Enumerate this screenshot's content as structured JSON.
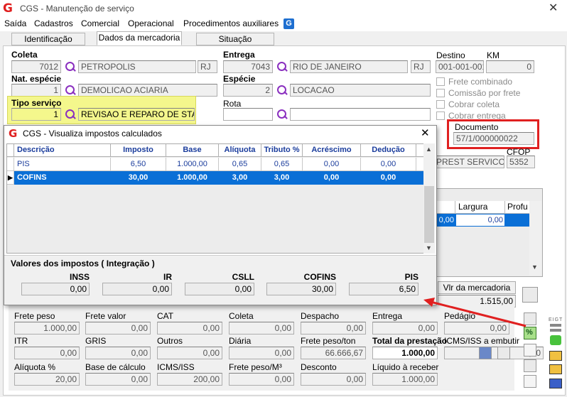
{
  "window": {
    "title": "CGS - Manutenção de serviço",
    "close": "✕"
  },
  "menu": [
    "Saída",
    "Cadastros",
    "Comercial",
    "Operacional",
    "Procedimentos auxiliares"
  ],
  "menu_badge": "G",
  "tabs": [
    "Identificação",
    "Dados da mercadoria",
    "Situação"
  ],
  "form": {
    "coleta": {
      "label": "Coleta",
      "code": "7012",
      "city": "PETROPOLIS",
      "uf": "RJ"
    },
    "entrega": {
      "label": "Entrega",
      "code": "7043",
      "city": "RIO DE JANEIRO",
      "uf": "RJ"
    },
    "destino": {
      "label": "Destino",
      "value": "001-001-001"
    },
    "km": {
      "label": "KM",
      "value": "0"
    },
    "nat_especie": {
      "label": "Nat. espécie",
      "code": "1",
      "value": "DEMOLICAO ACIARIA"
    },
    "especie": {
      "label": "Espécie",
      "code": "2",
      "value": "LOCACAO"
    },
    "tipo_servico": {
      "label": "Tipo serviço",
      "code": "1",
      "value": "REVISAO E REPARO DE STAND"
    },
    "rota": {
      "label": "Rota"
    },
    "checks": [
      "Frete combinado",
      "Comissão por frete",
      "Cobrar coleta",
      "Cobrar entrega"
    ],
    "documento": {
      "label": "Documento",
      "value": "57/1/000000022"
    },
    "cfop": {
      "label": "CFOP",
      "value": "5352",
      "text": "PREST SERVICO T"
    }
  },
  "right_grid": {
    "headers": [
      "Largura",
      "Profu"
    ],
    "row": [
      "0,00",
      "0,00"
    ]
  },
  "vlr_mercadoria": {
    "label": "Vlr da mercadoria",
    "value": "1.515,00"
  },
  "dialog": {
    "title": "CGS - Visualiza impostos calculados",
    "close": "✕",
    "headers": [
      "Descrição",
      "Imposto",
      "Base",
      "Alíquota",
      "Tributo %",
      "Acréscimo",
      "Dedução"
    ],
    "rows": [
      [
        "PIS",
        "6,50",
        "1.000,00",
        "0,65",
        "0,65",
        "0,00",
        "0,00"
      ],
      [
        "COFINS",
        "30,00",
        "1.000,00",
        "3,00",
        "3,00",
        "0,00",
        "0,00"
      ]
    ],
    "totals_title": "Valores dos impostos ( Integração )",
    "totals": [
      {
        "label": "INSS",
        "value": "0,00"
      },
      {
        "label": "IR",
        "value": "0,00"
      },
      {
        "label": "CSLL",
        "value": "0,00"
      },
      {
        "label": "COFINS",
        "value": "30,00"
      },
      {
        "label": "PIS",
        "value": "6,50"
      }
    ]
  },
  "freight": [
    {
      "label": "Frete peso",
      "value": "1.000,00"
    },
    {
      "label": "Frete valor",
      "value": "0,00"
    },
    {
      "label": "CAT",
      "value": "0,00"
    },
    {
      "label": "Coleta",
      "value": "0,00"
    },
    {
      "label": "Despacho",
      "value": "0,00"
    },
    {
      "label": "Entrega",
      "value": "0,00"
    },
    {
      "label": "Pedágio",
      "value": "0,00"
    },
    {
      "label": "ITR",
      "value": "0,00"
    },
    {
      "label": "GRIS",
      "value": "0,00"
    },
    {
      "label": "Outros",
      "value": "0,00"
    },
    {
      "label": "Diária",
      "value": "0,00"
    },
    {
      "label": "Frete peso/ton",
      "value": "66.666,67"
    },
    {
      "label": "Total da prestação",
      "value": "1.000,00"
    },
    {
      "label": "ICMS/ISS a embutir",
      "value": "0,00"
    },
    {
      "label": "Alíquota %",
      "value": "20,00"
    },
    {
      "label": "Base de cálculo",
      "value": "0,00"
    },
    {
      "label": "ICMS/ISS",
      "value": "200,00"
    },
    {
      "label": "Frete peso/M³",
      "value": "0,00"
    },
    {
      "label": "Desconto",
      "value": "0,00"
    },
    {
      "label": "Líquido à receber",
      "value": "1.000,00"
    }
  ],
  "side_label": "EIGT",
  "colors": {
    "accent": "#0a6fd6",
    "highlight": "#f4f78c",
    "arrow": "#e02020",
    "header_text": "#1a3c9c"
  }
}
